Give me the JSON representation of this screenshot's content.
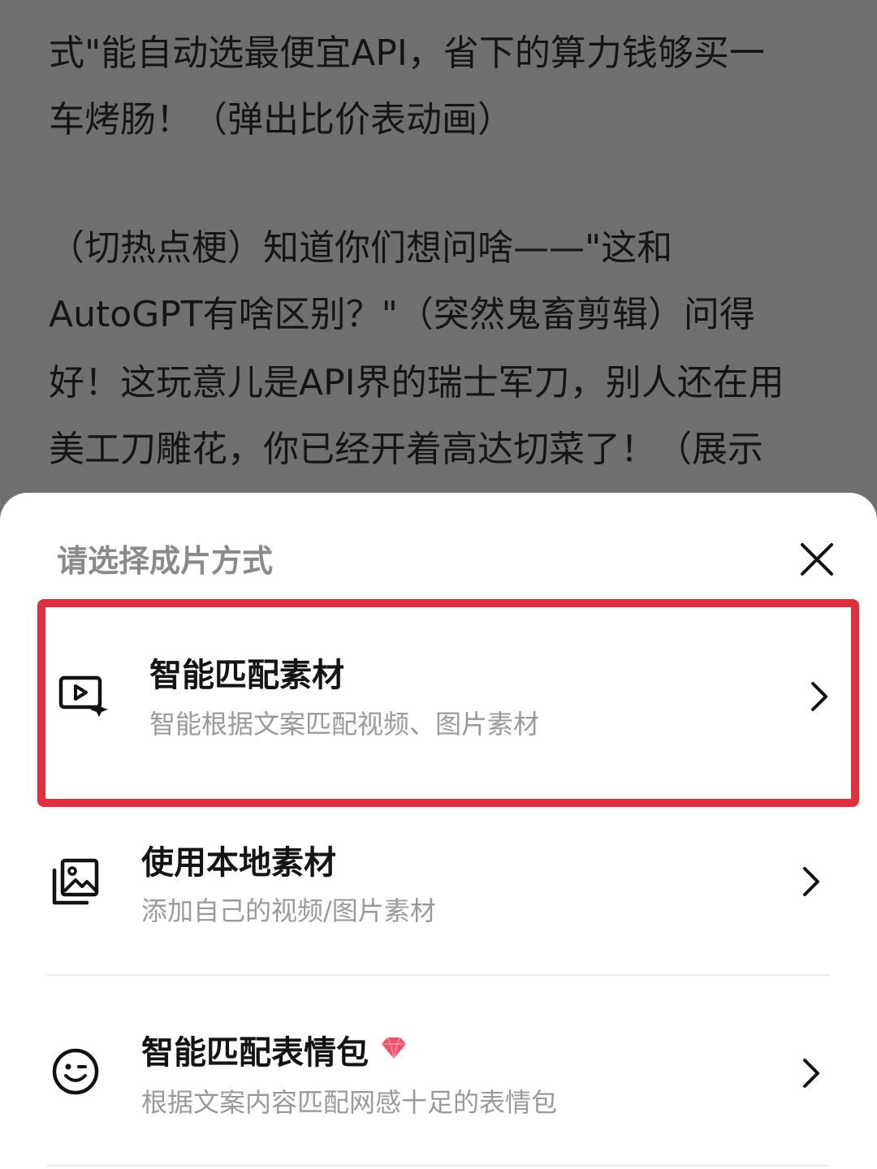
{
  "background_text": {
    "lines": [
      "式\"能自动选最便宜API，省下的算力钱够买一",
      "车烤肠！（弹出比价表动画）",
      "（切热点梗）知道你们想问啥——\"这和",
      "AutoGPT有啥区别？\"（突然鬼畜剪辑）问得",
      "好！这玩意儿是API界的瑞士军刀，别人还在用",
      "美工刀雕花，你已经开着高达切菜了！（展示"
    ]
  },
  "sheet": {
    "title": "请选择成片方式",
    "close_icon": "close-icon",
    "options": [
      {
        "title": "智能匹配素材",
        "subtitle": "智能根据文案匹配视频、图片素材",
        "icon": "video-sparkle-icon",
        "highlighted": true
      },
      {
        "title": "使用本地素材",
        "subtitle": "添加自己的视频/图片素材",
        "icon": "image-gallery-icon",
        "highlighted": false
      },
      {
        "title": "智能匹配表情包",
        "subtitle": "根据文案内容匹配网感十足的表情包",
        "icon": "emoji-wink-icon",
        "badge_icon": "vip-gem-icon",
        "highlighted": false
      }
    ]
  },
  "colors": {
    "highlight_border": "#e0303f",
    "overlay": "#707070",
    "gem": "#f0506a"
  }
}
